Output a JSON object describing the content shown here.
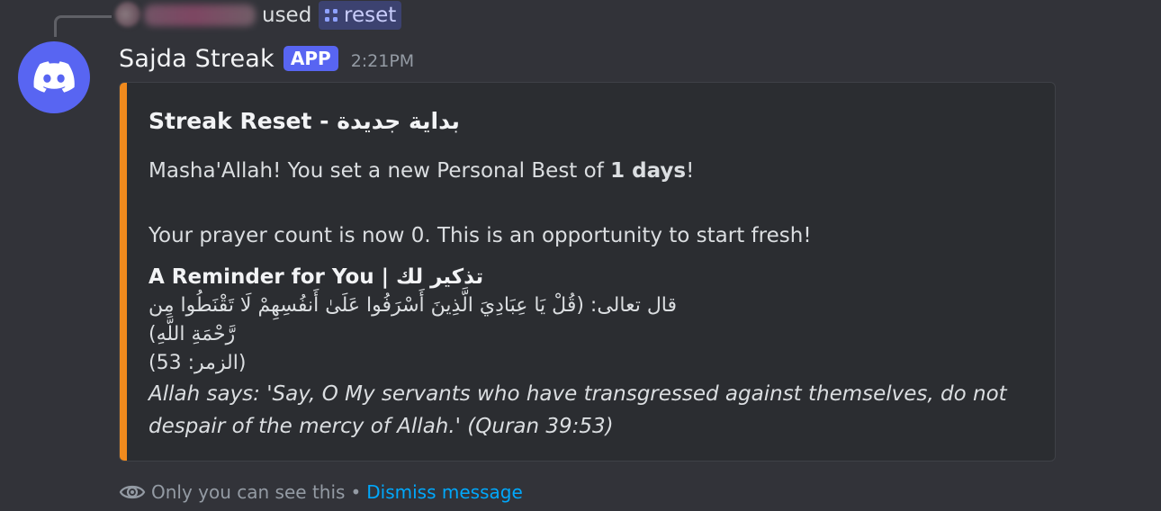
{
  "reply": {
    "used_text": "used",
    "command_name": "reset"
  },
  "message": {
    "username": "Sajda Streak",
    "badge": "APP",
    "timestamp": "2:21PM",
    "avatar_icon": "discord-logo-icon"
  },
  "embed": {
    "accent_color": "#f08a1d",
    "title": "Streak Reset - بداية جديدة",
    "paragraph1": {
      "prefix": "Masha'Allah! You set a new Personal Best of ",
      "bold": "1 days",
      "suffix": "!"
    },
    "paragraph2": "Your prayer count is now 0. This is an opportunity to start fresh!",
    "field": {
      "name": "A Reminder for You | تذكير لك",
      "arabic_line": "قال تعالى: (قُلْ يَا عِبَادِيَ الَّذِينَ أَسْرَفُوا عَلَىٰ أَنفُسِهِمْ لَا تَقْنَطُوا مِن رَّحْمَةِ اللَّهِ)",
      "surah_ref": "(الزمر: 53)",
      "translation": "Allah says: 'Say, O My servants who have transgressed against themselves, do not despair of the mercy of Allah.' (Quran 39:53)"
    }
  },
  "footer": {
    "only_you": "Only you can see this",
    "separator": "•",
    "dismiss": "Dismiss message"
  },
  "colors": {
    "background": "#323339",
    "embed_bg": "#2b2d31",
    "blurple": "#5865f2",
    "link": "#00a8fc",
    "muted": "#949ba4"
  }
}
